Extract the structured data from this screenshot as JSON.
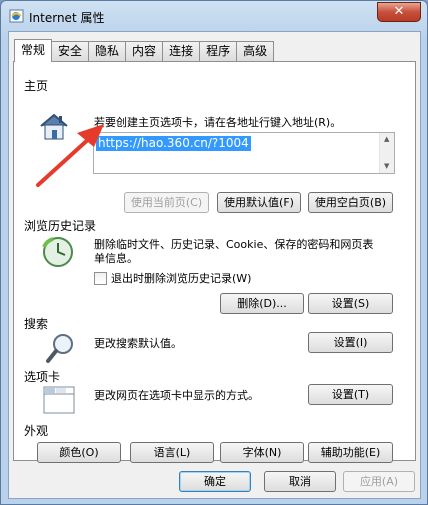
{
  "window": {
    "title": "Internet 属性",
    "close_label": "✕"
  },
  "tabs": [
    "常规",
    "安全",
    "隐私",
    "内容",
    "连接",
    "程序",
    "高级"
  ],
  "homepage": {
    "title": "主页",
    "description": "若要创建主页选项卡，请在各地址行键入地址(R)。",
    "url": "https://hao.360.cn/?1004",
    "use_current": "使用当前页(C)",
    "use_default": "使用默认值(F)",
    "use_blank": "使用空白页(B)"
  },
  "history": {
    "title": "浏览历史记录",
    "description": "删除临时文件、历史记录、Cookie、保存的密码和网页表单信息。",
    "checkbox_label": "退出时删除浏览历史记录(W)",
    "delete_button": "删除(D)...",
    "settings_button": "设置(S)"
  },
  "search": {
    "title": "搜索",
    "description": "更改搜索默认值。",
    "settings_button": "设置(I)"
  },
  "tabs_section": {
    "title": "选项卡",
    "description": "更改网页在选项卡中显示的方式。",
    "settings_button": "设置(T)"
  },
  "appearance": {
    "title": "外观",
    "colors": "颜色(O)",
    "languages": "语言(L)",
    "fonts": "字体(N)",
    "accessibility": "辅助功能(E)"
  },
  "footer": {
    "ok": "确定",
    "cancel": "取消",
    "apply": "应用(A)"
  },
  "colors": {
    "selection": "#3399ff",
    "arrow": "#e53a2c"
  }
}
